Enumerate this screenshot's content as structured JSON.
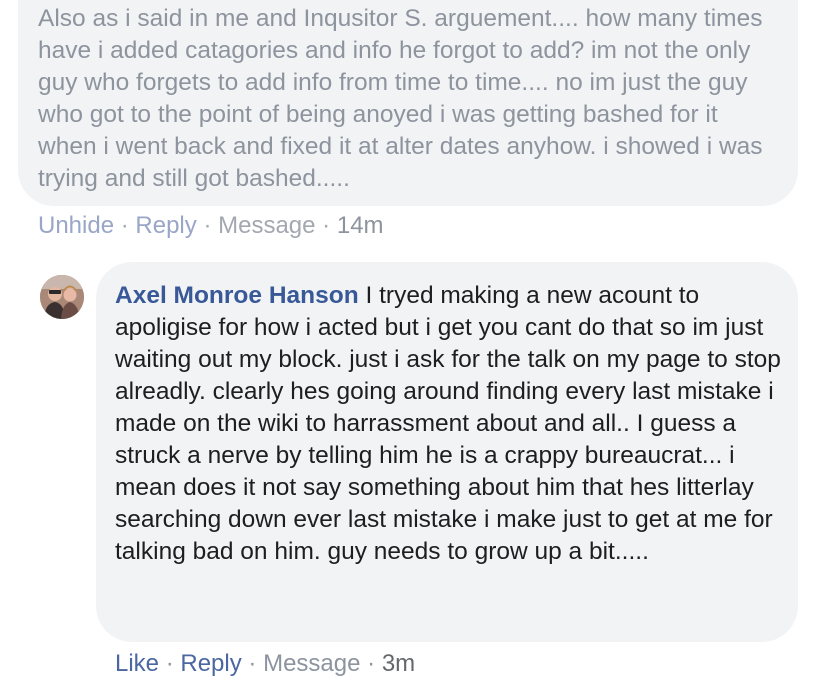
{
  "comments": [
    {
      "author": "",
      "text": "Also as i said in me and Inqusitor S. arguement.... how many times have i added catagories and info he forgot to add? im not the only guy who forgets to add info from time to time.... no im just the guy who got to the point of being anoyed i was getting bashed for it when i went back and fixed it at alter dates anyhow. i showed i was trying and still got bashed.....",
      "actions": {
        "primary": "Unhide",
        "reply": "Reply",
        "message": "Message",
        "time": "14m",
        "separator": "·"
      }
    },
    {
      "author": "Axel Monroe Hanson",
      "text": "I tryed making a new acount to apoligise for how i acted but i get you cant do that so im just waiting out my block. just i ask for the talk on my page to stop alreadly. clearly hes going around finding every last mistake i made on the wiki to harrassment about and all.. I guess a struck a nerve by telling him he is a crappy bureaucrat... i mean does it not say something about him that hes litterlay searching down ever last mistake i make just to get at me for talking bad on him. guy needs to grow up a bit.....",
      "actions": {
        "primary": "Like",
        "reply": "Reply",
        "message": "Message",
        "time": "3m",
        "separator": "·"
      }
    }
  ],
  "colors": {
    "bubble": "#f2f3f5",
    "author_link": "#385898",
    "action_link": "#4b67a1",
    "muted": "#8d949e"
  }
}
